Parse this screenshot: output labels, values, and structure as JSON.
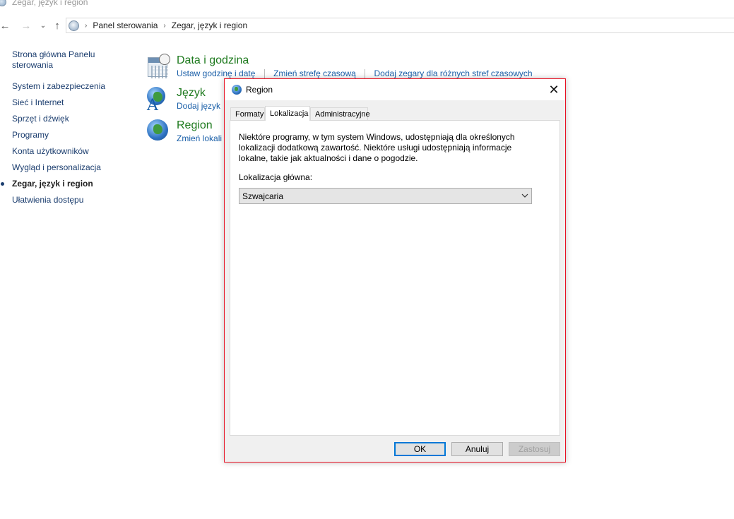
{
  "window": {
    "title": "Zegar, język i region"
  },
  "address": {
    "crumbs": [
      "Panel sterowania",
      "Zegar, język i region"
    ]
  },
  "left_nav": {
    "home": "Strona główna Panelu sterowania",
    "items": [
      "System i zabezpieczenia",
      "Sieć i Internet",
      "Sprzęt i dźwięk",
      "Programy",
      "Konta użytkowników",
      "Wygląd i personalizacja",
      "Zegar, język i region",
      "Ułatwienia dostępu"
    ],
    "current_index": 6
  },
  "groups": {
    "datetime": {
      "title": "Data i godzina",
      "links": [
        "Ustaw godzinę i datę",
        "Zmień strefę czasową",
        "Dodaj zegary dla różnych stref czasowych"
      ],
      "icon": "calendar-clock-icon"
    },
    "language": {
      "title": "Język",
      "links": [
        "Dodaj język"
      ],
      "icon": "language-globe-icon"
    },
    "region": {
      "title": "Region",
      "links": [
        "Zmień lokali"
      ],
      "icon": "region-globe-icon"
    }
  },
  "dialog": {
    "title": "Region",
    "close_glyph": "✕",
    "tabs": [
      "Formaty",
      "Lokalizacja",
      "Administracyjne"
    ],
    "active_tab": "Lokalizacja",
    "description": "Niektóre programy, w tym system Windows, udostępniają dla określonych lokalizacji dodatkową zawartość. Niektóre usługi udostępniają informacje lokalne, takie jak aktualności i dane o pogodzie.",
    "location_label": "Lokalizacja główna:",
    "location_value": "Szwajcaria",
    "buttons": {
      "ok": "OK",
      "cancel": "Anuluj",
      "apply": "Zastosuj"
    }
  },
  "colors": {
    "dialog_border": "#e81123",
    "group_title": "#1e7a1e",
    "link": "#1a5fa8",
    "ok_focus": "#0078d7"
  }
}
